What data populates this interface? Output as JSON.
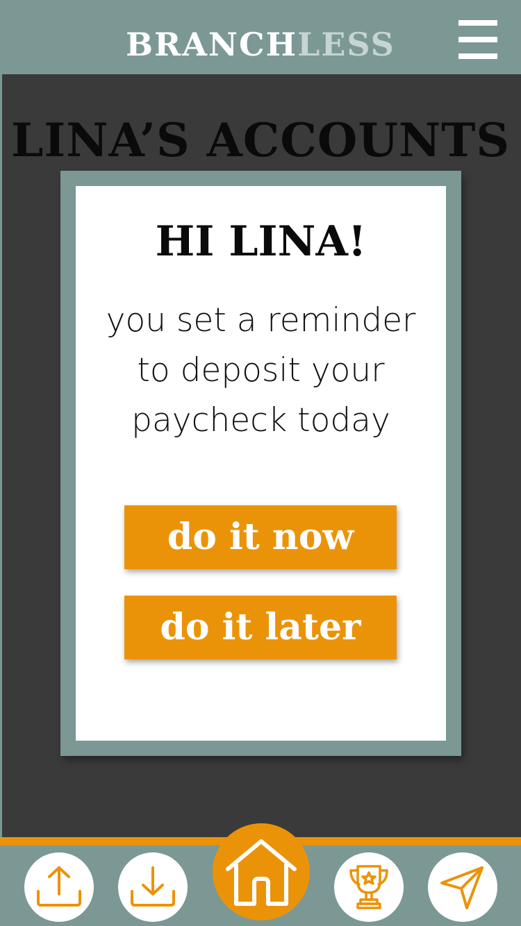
{
  "header": {
    "brand_part1": "BRANCH",
    "brand_part2": "LESS",
    "menu_icon": "hamburger-menu-icon"
  },
  "page": {
    "title": "LINA’S ACCOUNTS"
  },
  "reminder_card": {
    "greeting": "HI LINA!",
    "message_line1": "you set a reminder",
    "message_line2": "to deposit your",
    "message_line3": "paycheck today",
    "primary_button": "do it now",
    "secondary_button": "do it later"
  },
  "bottom_nav": {
    "items": [
      {
        "icon": "upload-icon"
      },
      {
        "icon": "download-icon"
      },
      {
        "icon": "home-icon",
        "active": true
      },
      {
        "icon": "trophy-icon"
      },
      {
        "icon": "send-icon"
      }
    ]
  },
  "colors": {
    "header_bg": "#7b9895",
    "page_bg": "#3a3a3a",
    "accent": "#eb9308",
    "card_bg": "#ffffff",
    "brand_light": "#c6d4d2"
  }
}
